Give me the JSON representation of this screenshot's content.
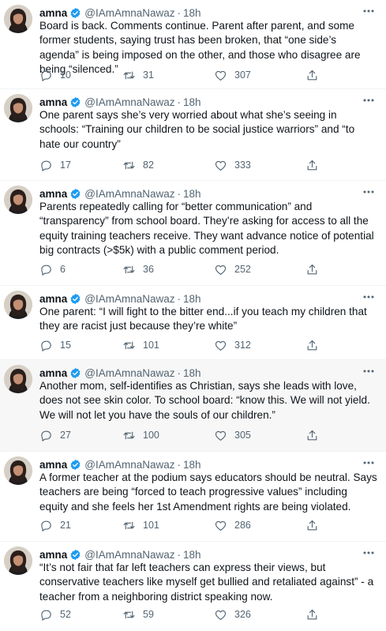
{
  "tweets": [
    {
      "name": "amna",
      "handle": "@IAmAmnaNawaz",
      "separator": "·",
      "time": "18h",
      "text": "Board is back. Comments continue. Parent after parent, and some former students, saying trust has been broken, that “one side’s agenda” is being imposed on the other, and those who disagree are being “silenced.”",
      "replies": "10",
      "retweets": "31",
      "likes": "307"
    },
    {
      "name": "amna",
      "handle": "@IAmAmnaNawaz",
      "separator": "·",
      "time": "18h",
      "text": "One parent says she’s very worried about what she’s seeing in schools: “Training our children to be social justice warriors” and “to hate our country”",
      "replies": "17",
      "retweets": "82",
      "likes": "333"
    },
    {
      "name": "amna",
      "handle": "@IAmAmnaNawaz",
      "separator": "·",
      "time": "18h",
      "text": "Parents repeatedly calling for “better communication” and “transparency” from school board. They’re asking for access to all the equity training teachers receive. They want advance notice of potential big contracts (>$5k) with a public comment period.",
      "replies": "6",
      "retweets": "36",
      "likes": "252"
    },
    {
      "name": "amna",
      "handle": "@IAmAmnaNawaz",
      "separator": "·",
      "time": "18h",
      "text": "One parent: “I will fight to the bitter end...if you teach my children that they are racist just because they’re white”",
      "replies": "15",
      "retweets": "101",
      "likes": "312"
    },
    {
      "name": "amna",
      "handle": "@IAmAmnaNawaz",
      "separator": "·",
      "time": "18h",
      "text": "Another mom, self-identifies as Christian, says she leads with love, does not see skin color. To school board: “know this. We will not yield. We will not let you have the souls of our children.”",
      "replies": "27",
      "retweets": "100",
      "likes": "305"
    },
    {
      "name": "amna",
      "handle": "@IAmAmnaNawaz",
      "separator": "·",
      "time": "18h",
      "text": "A former teacher at the podium says educators should be neutral. Says teachers are being “forced to teach progressive values” including equity and she feels her 1st Amendment rights are being violated.",
      "replies": "21",
      "retweets": "101",
      "likes": "286"
    },
    {
      "name": "amna",
      "handle": "@IAmAmnaNawaz",
      "separator": "·",
      "time": "18h",
      "text": "“It’s not fair that far left teachers can express their views, but conservative teachers like myself get bullied and retaliated against” - a teacher from a neighboring district speaking now.",
      "replies": "52",
      "retweets": "59",
      "likes": "326"
    }
  ],
  "icons": {
    "verified": "verified-badge-icon",
    "more": "more-dots-icon",
    "reply": "reply-icon",
    "retweet": "retweet-icon",
    "like": "heart-icon",
    "share": "share-icon"
  },
  "colors": {
    "verified": "#1d9bf0",
    "text": "#0f1419",
    "muted": "#536471",
    "highlight_bg": "#f7f7f7"
  }
}
